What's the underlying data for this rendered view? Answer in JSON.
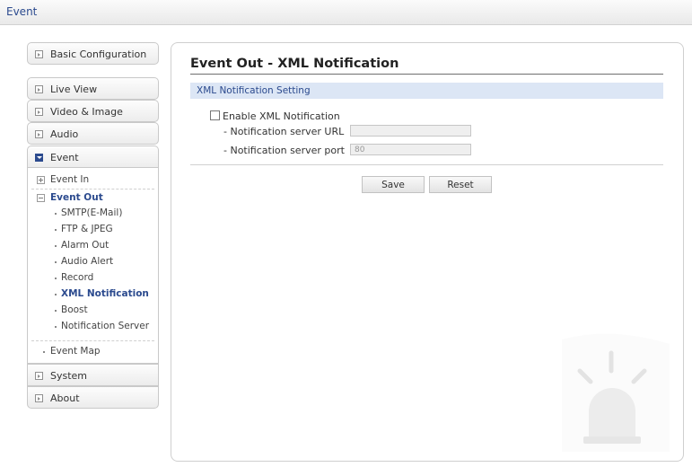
{
  "topbar": {
    "title": "Event"
  },
  "sidebar": {
    "items": [
      {
        "label": "Basic Configuration"
      },
      {
        "label": "Live View"
      },
      {
        "label": "Video & Image"
      },
      {
        "label": "Audio"
      },
      {
        "label": "Event"
      },
      {
        "label": "System"
      },
      {
        "label": "About"
      }
    ],
    "event_submenu": {
      "event_in": "Event In",
      "event_out": "Event Out",
      "event_out_items": [
        "SMTP(E-Mail)",
        "FTP & JPEG",
        "Alarm Out",
        "Audio Alert",
        "Record",
        "XML Notification",
        "Boost",
        "Notification Server"
      ],
      "event_map": "Event Map"
    }
  },
  "main": {
    "title": "Event Out - XML Notification",
    "section_header": "XML Notification Setting",
    "enable_checkbox": {
      "label": "Enable XML Notification",
      "checked": false
    },
    "server_url": {
      "label": "- Notification server URL",
      "value": ""
    },
    "server_port": {
      "label": "- Notification server port",
      "value": "80"
    },
    "save_label": "Save",
    "reset_label": "Reset"
  },
  "icons": {
    "sidebar_collapsed": "expand-box-icon",
    "sidebar_expanded": "collapse-box-icon",
    "tree_plus": "plus-icon",
    "tree_minus": "minus-icon",
    "decoration": "alarm-light-icon"
  },
  "colors": {
    "accent": "#2b4a8e",
    "section_bg": "#dce6f5"
  }
}
